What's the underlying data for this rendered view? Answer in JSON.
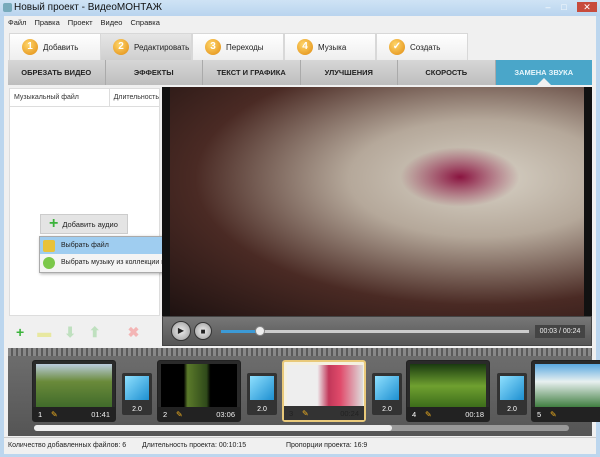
{
  "window": {
    "title": "Новый проект - ВидеоМОНТАЖ",
    "controls": [
      "–",
      "□",
      "✕"
    ]
  },
  "menu": [
    "Файл",
    "Правка",
    "Проект",
    "Видео",
    "Справка"
  ],
  "steps": [
    {
      "num": "1",
      "label": "Добавить"
    },
    {
      "num": "2",
      "label": "Редактировать",
      "active": true
    },
    {
      "num": "3",
      "label": "Переходы"
    },
    {
      "num": "4",
      "label": "Музыка"
    },
    {
      "num": "✓",
      "label": "Создать"
    }
  ],
  "subtabs": [
    {
      "label": "ОБРЕЗАТЬ ВИДЕО"
    },
    {
      "label": "ЭФФЕКТЫ"
    },
    {
      "label": "ТЕКСТ И ГРАФИКА"
    },
    {
      "label": "УЛУЧШЕНИЯ"
    },
    {
      "label": "СКОРОСТЬ"
    },
    {
      "label": "ЗАМЕНА ЗВУКА",
      "active": true
    }
  ],
  "audio_panel": {
    "col_file": "Музыкальный файл",
    "col_duration": "Длительность",
    "add_audio": "Добавить аудио",
    "menu": [
      {
        "label": "Выбрать файл",
        "icon": "folder-icon"
      },
      {
        "label": "Выбрать музыку из коллекции программы",
        "icon": "music-note-icon"
      }
    ]
  },
  "player": {
    "time": "00:03 / 00:24",
    "progress": 0.125
  },
  "clips": [
    {
      "n": "1",
      "duration": "01:41"
    },
    {
      "n": "2",
      "duration": "03:06"
    },
    {
      "n": "3",
      "duration": "00:24",
      "selected": true
    },
    {
      "n": "4",
      "duration": "00:18"
    },
    {
      "n": "5",
      "duration": ""
    }
  ],
  "transitions": [
    "2.0",
    "2.0",
    "2.0",
    "2.0"
  ],
  "status": {
    "files": "Количество добавленных файлов: 6",
    "duration": "Длительность проекта: 00:10:15",
    "ratio": "Пропорции проекта: 16:9"
  },
  "colors": {
    "accent": "#4aa6c9",
    "selected_clip": "#e9c97a"
  }
}
